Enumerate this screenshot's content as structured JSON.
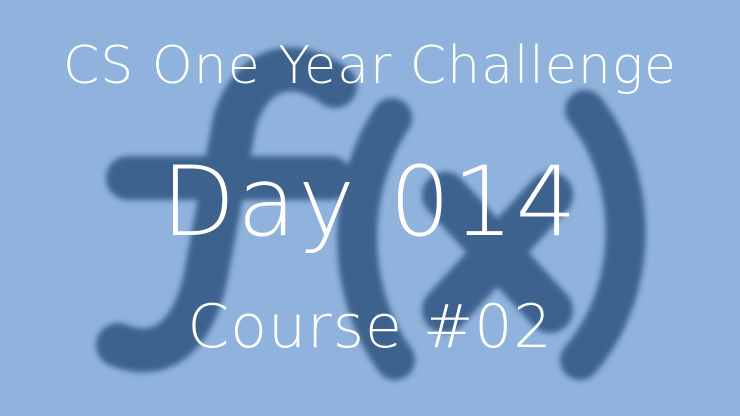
{
  "background": {
    "color": "#8fb3dc",
    "symbol_color": "#3d628d",
    "symbol_icon": "function-fx-icon"
  },
  "titles": {
    "challenge": "CS One Year Challenge",
    "day": "Day 014",
    "course": "Course #02"
  },
  "colors": {
    "text": "#ffffff"
  }
}
